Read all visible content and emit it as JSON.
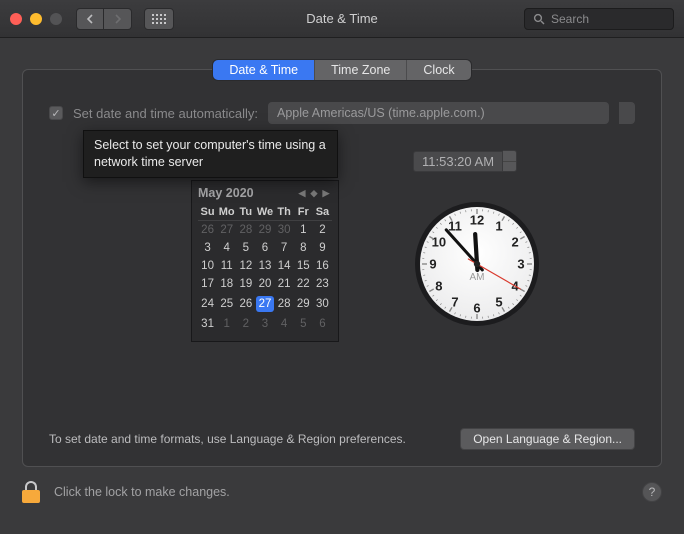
{
  "window": {
    "title": "Date & Time",
    "search_placeholder": "Search"
  },
  "tabs": {
    "date_time": "Date & Time",
    "time_zone": "Time Zone",
    "clock": "Clock"
  },
  "auto": {
    "checked": true,
    "label": "Set date and time automatically:",
    "server": "Apple Americas/US (time.apple.com.)"
  },
  "tooltip": "Select to set your computer's time using a network time server",
  "digital_time": "11:53:20 AM",
  "calendar": {
    "month_label": "May 2020",
    "weekdays": [
      "Su",
      "Mo",
      "Tu",
      "We",
      "Th",
      "Fr",
      "Sa"
    ],
    "weeks": [
      [
        {
          "d": 26,
          "off": true
        },
        {
          "d": 27,
          "off": true
        },
        {
          "d": 28,
          "off": true
        },
        {
          "d": 29,
          "off": true
        },
        {
          "d": 30,
          "off": true
        },
        {
          "d": 1
        },
        {
          "d": 2
        }
      ],
      [
        {
          "d": 3
        },
        {
          "d": 4
        },
        {
          "d": 5
        },
        {
          "d": 6
        },
        {
          "d": 7
        },
        {
          "d": 8
        },
        {
          "d": 9
        }
      ],
      [
        {
          "d": 10
        },
        {
          "d": 11
        },
        {
          "d": 12
        },
        {
          "d": 13
        },
        {
          "d": 14
        },
        {
          "d": 15
        },
        {
          "d": 16
        }
      ],
      [
        {
          "d": 17
        },
        {
          "d": 18
        },
        {
          "d": 19
        },
        {
          "d": 20
        },
        {
          "d": 21
        },
        {
          "d": 22
        },
        {
          "d": 23
        }
      ],
      [
        {
          "d": 24
        },
        {
          "d": 25
        },
        {
          "d": 26
        },
        {
          "d": 27,
          "today": true
        },
        {
          "d": 28
        },
        {
          "d": 29
        },
        {
          "d": 30
        }
      ],
      [
        {
          "d": 31
        },
        {
          "d": 1,
          "off": true
        },
        {
          "d": 2,
          "off": true
        },
        {
          "d": 3,
          "off": true
        },
        {
          "d": 4,
          "off": true
        },
        {
          "d": 5,
          "off": true
        },
        {
          "d": 6,
          "off": true
        }
      ]
    ]
  },
  "clock": {
    "ampm": "AM",
    "hour": 11,
    "minute": 53,
    "second": 20
  },
  "hint": {
    "text": "To set date and time formats, use Language & Region preferences.",
    "button": "Open Language & Region..."
  },
  "footer": {
    "lock_text": "Click the lock to make changes."
  }
}
